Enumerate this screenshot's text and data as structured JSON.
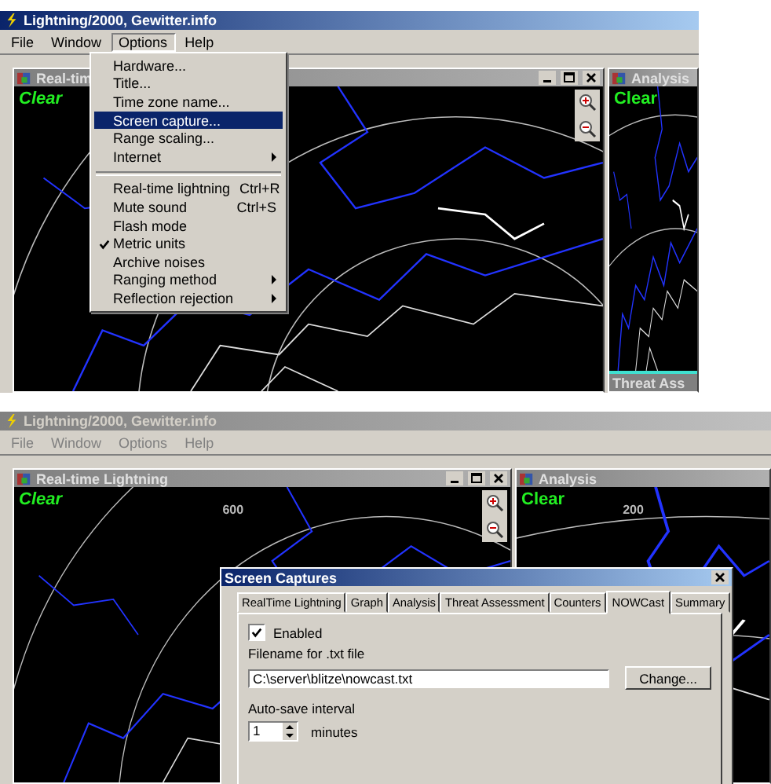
{
  "screens": [
    {
      "title": "Lightning/2000, Gewitter.info",
      "active": true,
      "menu_enabled": true,
      "menu": [
        {
          "label": "File",
          "selected": false
        },
        {
          "label": "Window",
          "selected": false
        },
        {
          "label": "Options",
          "selected": true
        },
        {
          "label": "Help",
          "selected": false
        }
      ],
      "open_menu": [
        {
          "kind": "item",
          "label": "Hardware...",
          "selected": false
        },
        {
          "kind": "item",
          "label": "Title...",
          "selected": false
        },
        {
          "kind": "item",
          "label": "Time zone name...",
          "selected": false
        },
        {
          "kind": "item",
          "label": "Screen capture...",
          "selected": true
        },
        {
          "kind": "item",
          "label": "Range scaling...",
          "selected": false
        },
        {
          "kind": "submenu",
          "label": "Internet",
          "selected": false
        },
        {
          "kind": "separator"
        },
        {
          "kind": "item",
          "label": "Real-time lightning",
          "shortcut": "Ctrl+R",
          "selected": false
        },
        {
          "kind": "item",
          "label": "Mute sound",
          "shortcut": "Ctrl+S",
          "selected": false
        },
        {
          "kind": "item",
          "label": "Flash mode",
          "selected": false
        },
        {
          "kind": "item",
          "label": "Metric units",
          "checked": true,
          "selected": false
        },
        {
          "kind": "item",
          "label": "Archive noises",
          "selected": false
        },
        {
          "kind": "submenu",
          "label": "Ranging method",
          "selected": false
        },
        {
          "kind": "submenu",
          "label": "Reflection rejection",
          "selected": false
        }
      ],
      "main_window": {
        "title": "Real-tim",
        "status": "Clear"
      },
      "side_window": {
        "title": "Analysis",
        "status": "Clear",
        "footer": "Threat Ass"
      }
    },
    {
      "title": "Lightning/2000, Gewitter.info",
      "active": false,
      "menu_enabled": false,
      "menu": [
        {
          "label": "File",
          "selected": false
        },
        {
          "label": "Window",
          "selected": false
        },
        {
          "label": "Options",
          "selected": false
        },
        {
          "label": "Help",
          "selected": false
        }
      ],
      "main_window": {
        "title": "Real-time Lightning",
        "status": "Clear",
        "range_label": "600"
      },
      "side_window": {
        "title": "Analysis",
        "status": "Clear",
        "range_label": "200"
      },
      "dialog": {
        "title": "Screen Captures",
        "tabs": [
          {
            "label": "RealTime Lightning",
            "selected": false
          },
          {
            "label": "Graph",
            "selected": false
          },
          {
            "label": "Analysis",
            "selected": false
          },
          {
            "label": "Threat Assessment",
            "selected": false
          },
          {
            "label": "Counters",
            "selected": false
          },
          {
            "label": "NOWCast",
            "selected": true
          },
          {
            "label": "Summary",
            "selected": false
          }
        ],
        "enabled": {
          "label": "Enabled",
          "checked": true
        },
        "filename": {
          "label": "Filename for .txt file",
          "value": "C:\\server\\blitze\\nowcast.txt",
          "button": "Change..."
        },
        "interval": {
          "label": "Auto-save interval",
          "value": "1",
          "unit": "minutes"
        }
      }
    }
  ]
}
